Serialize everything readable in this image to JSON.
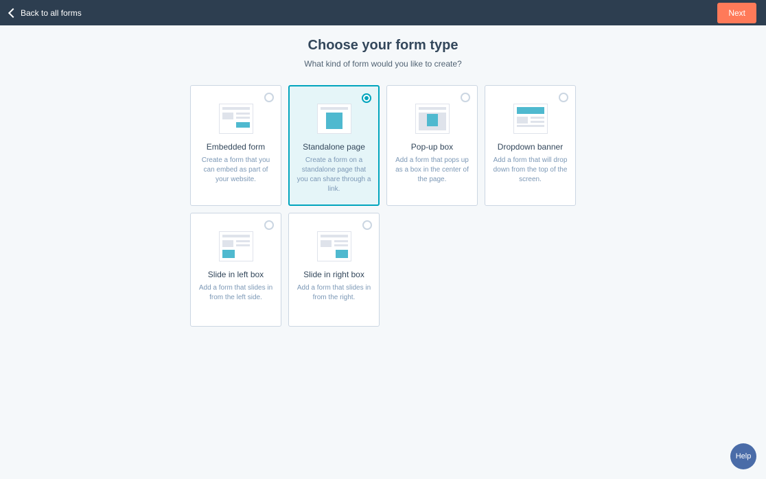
{
  "topbar": {
    "back_label": "Back to all forms",
    "next_label": "Next"
  },
  "page": {
    "title": "Choose your form type",
    "subtitle": "What kind of form would you like to create?"
  },
  "cards": [
    {
      "id": "embedded",
      "title": "Embedded form",
      "desc": "Create a form that you can embed as part of your website.",
      "selected": false
    },
    {
      "id": "standalone",
      "title": "Standalone page",
      "desc": "Create a form on a standalone page that you can share through a link.",
      "selected": true
    },
    {
      "id": "popup",
      "title": "Pop-up box",
      "desc": "Add a form that pops up as a box in the center of the page.",
      "selected": false
    },
    {
      "id": "dropdown",
      "title": "Dropdown banner",
      "desc": "Add a form that will drop down from the top of the screen.",
      "selected": false
    },
    {
      "id": "slide-left",
      "title": "Slide in left box",
      "desc": "Add a form that slides in from the left side.",
      "selected": false
    },
    {
      "id": "slide-right",
      "title": "Slide in right box",
      "desc": "Add a form that slides in from the right.",
      "selected": false
    }
  ],
  "help": {
    "label": "Help"
  }
}
